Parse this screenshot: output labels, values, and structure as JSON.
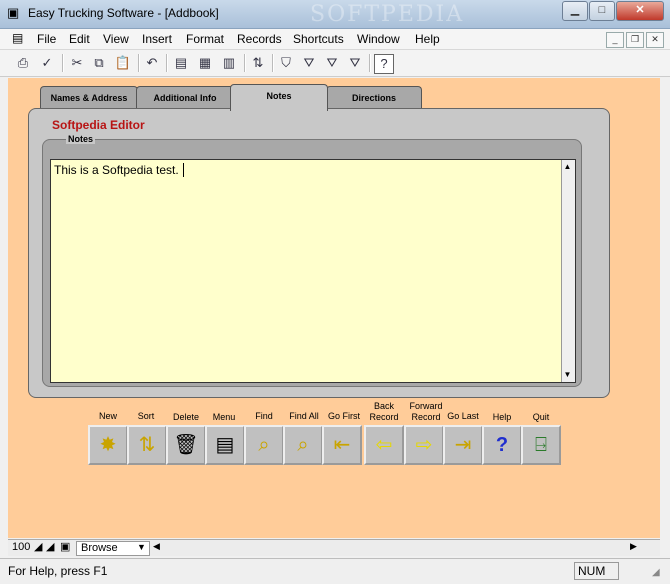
{
  "window": {
    "title": "Easy Trucking Software - [Addbook]",
    "watermark": "SOFTPEDIA"
  },
  "menu": {
    "items": [
      "File",
      "Edit",
      "View",
      "Insert",
      "Format",
      "Records",
      "Shortcuts",
      "Window",
      "Help"
    ]
  },
  "tabs": [
    {
      "label": "Names & Address",
      "active": false
    },
    {
      "label": "Additional Info",
      "active": false
    },
    {
      "label": "Notes",
      "active": true
    },
    {
      "label": "Directions",
      "active": false
    }
  ],
  "editor": {
    "title": "Softpedia Editor",
    "group_label": "Notes",
    "notes_text": "This is a Softpedia test."
  },
  "actions": [
    {
      "label": "New",
      "icon": "new-record-icon"
    },
    {
      "label": "Sort",
      "icon": "sort-icon"
    },
    {
      "label": "Delete",
      "icon": "trash-icon"
    },
    {
      "label": "Menu",
      "icon": "menu-icon"
    },
    {
      "label": "Find",
      "icon": "find-icon"
    },
    {
      "label": "Find All",
      "icon": "find-all-icon"
    },
    {
      "label": "Go First",
      "icon": "go-first-icon"
    },
    {
      "label": "Back Record",
      "icon": "arrow-left-icon"
    },
    {
      "label": "Forward Record",
      "icon": "arrow-right-icon"
    },
    {
      "label": "Go Last",
      "icon": "go-last-icon"
    },
    {
      "label": "Help",
      "icon": "question-icon"
    },
    {
      "label": "Quit",
      "icon": "exit-door-icon"
    }
  ],
  "bottom": {
    "zoom": "100",
    "mode": "Browse"
  },
  "status": {
    "help": "For Help, press F1",
    "num": "NUM"
  },
  "colors": {
    "client_bg": "#ffcc99",
    "notes_bg": "#ffffcc",
    "editor_title": "#b81414"
  }
}
